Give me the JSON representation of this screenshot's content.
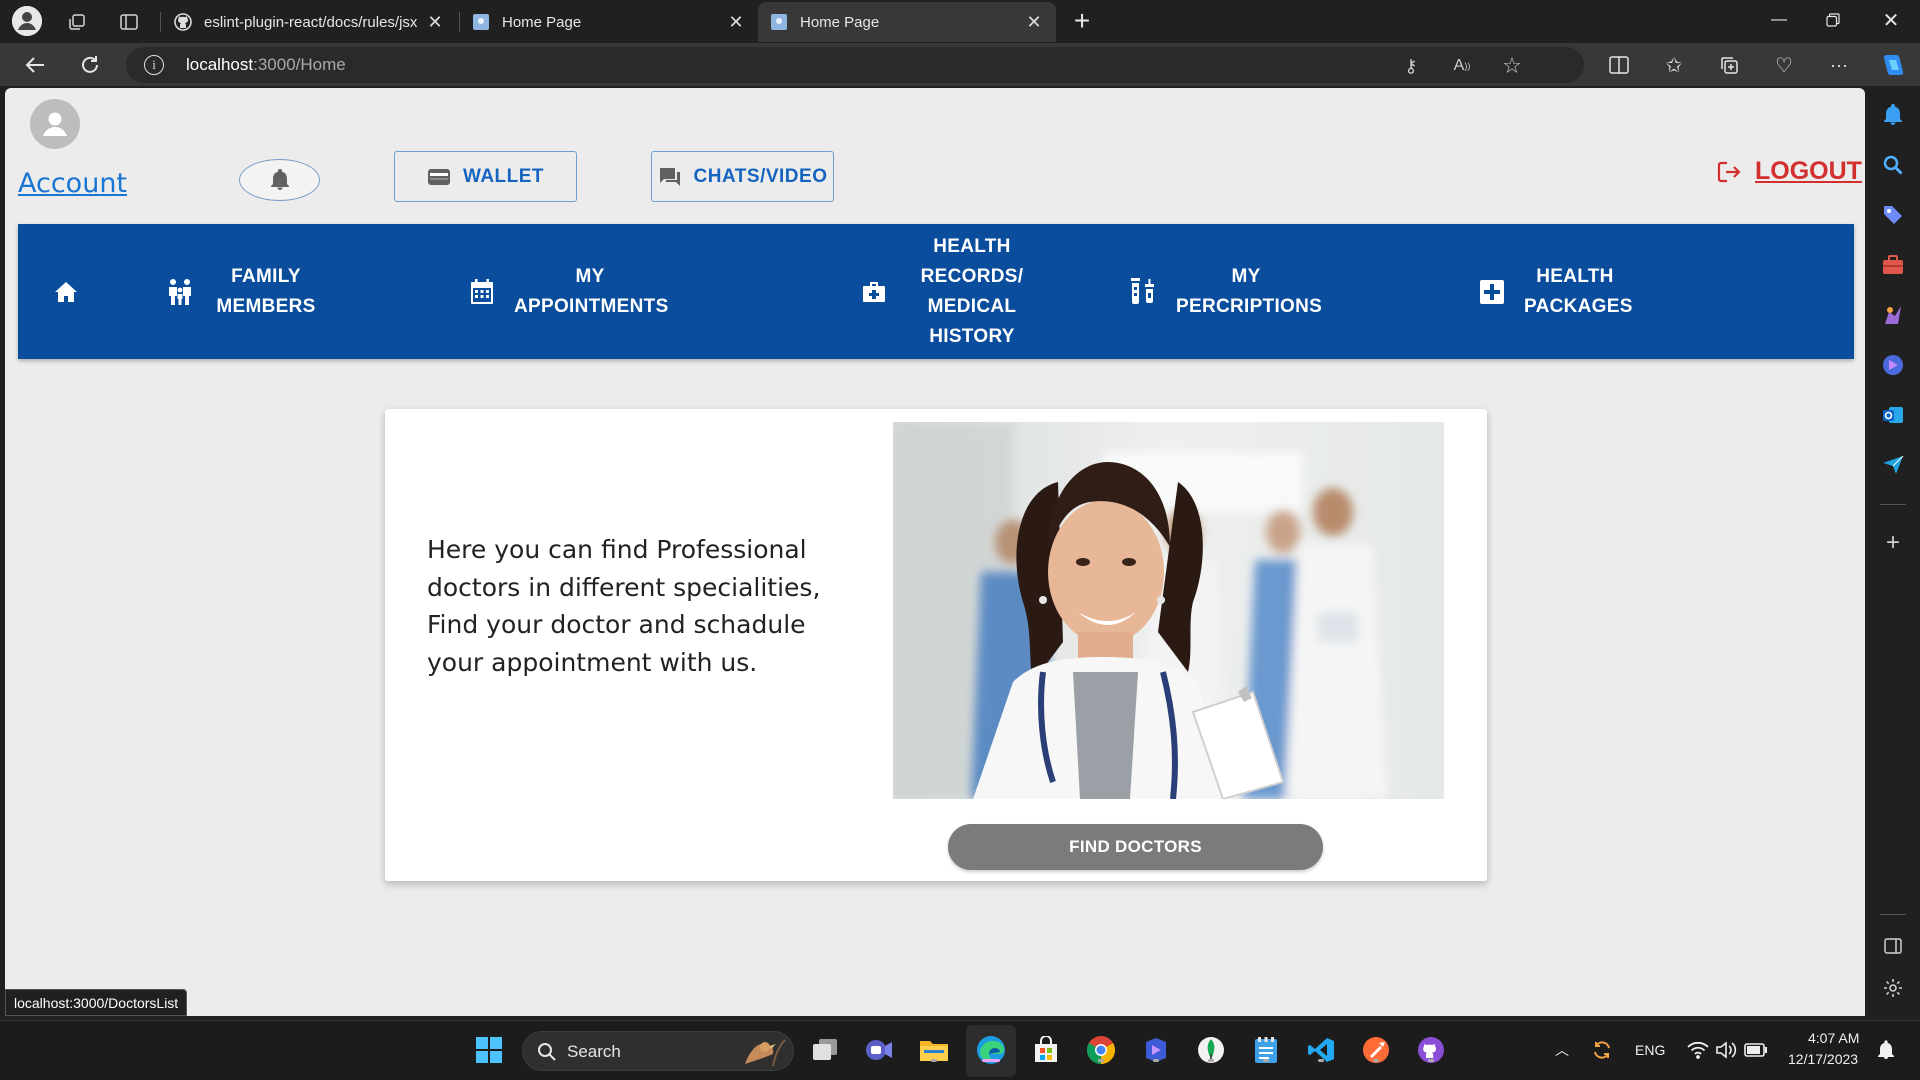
{
  "browser": {
    "tabs": [
      {
        "title": "eslint-plugin-react/docs/rules/jsx",
        "favicon": "github-icon",
        "active": false
      },
      {
        "title": "Home Page",
        "favicon": "page-icon",
        "active": false
      },
      {
        "title": "Home Page",
        "favicon": "page-icon",
        "active": true
      }
    ],
    "url_host": "localhost",
    "url_path": ":3000/Home",
    "status_url": "localhost:3000/DoctorsList"
  },
  "header": {
    "account_label": "Account",
    "wallet_label": "WALLET",
    "chats_label": "CHATS/VIDEO",
    "logout_label": "LOGOUT"
  },
  "nav": {
    "home_icon": "home-icon",
    "items": [
      {
        "line1": "FAMILY",
        "line2": "MEMBERS",
        "icon": "family-icon"
      },
      {
        "line1": "MY",
        "line2": "APPOINTMENTS",
        "icon": "calendar-icon"
      },
      {
        "line1": "HEALTH",
        "line2": "RECORDS/",
        "line3": "MEDICAL",
        "line4": "HISTORY",
        "icon": "medical-bag-icon"
      },
      {
        "line1": "MY",
        "line2": "PERCRIPTIONS",
        "icon": "vaccine-icon"
      },
      {
        "line1": "HEALTH",
        "line2": "PACKAGES",
        "icon": "medical-plus-icon"
      }
    ]
  },
  "card": {
    "description": "Here you can find Professional doctors in different specialities, Find your doctor and schadule your appointment with us.",
    "button_label": "FIND DOCTORS"
  },
  "taskbar": {
    "search_label": "Search",
    "language": "ENG",
    "time": "4:07 AM",
    "date": "12/17/2023"
  },
  "colors": {
    "navbar": "#0a4d9d",
    "link": "#1976d2",
    "logout": "#d32f2f",
    "button_grey": "#7b7b7b",
    "page_bg": "#ececec"
  }
}
